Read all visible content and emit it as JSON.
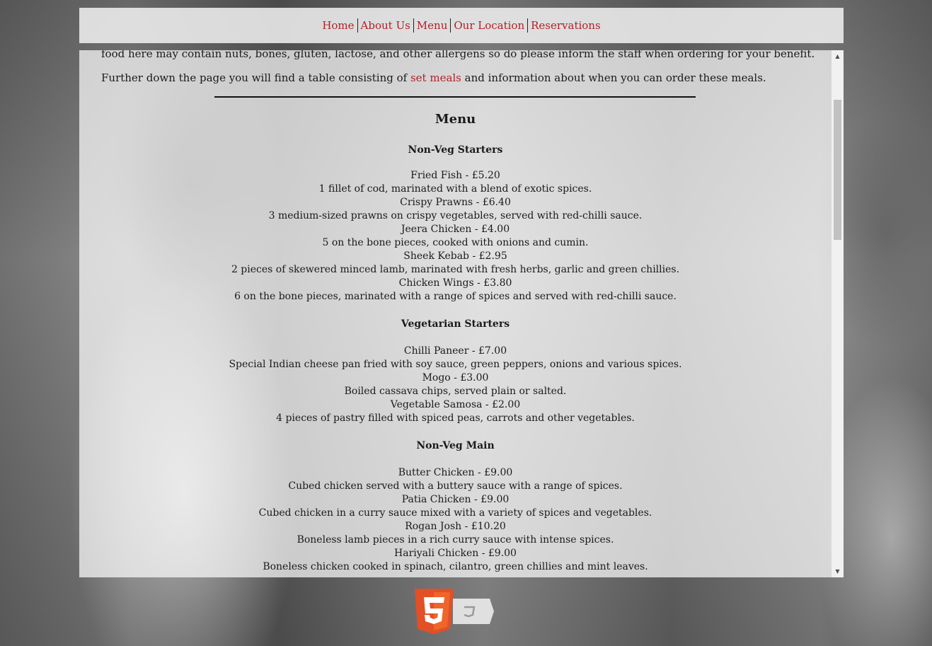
{
  "nav": {
    "items": [
      "Home",
      "About Us",
      "Menu",
      "Our Location",
      "Reservations"
    ]
  },
  "intro": {
    "allergen_line": "food here may contain nuts, bones, gluten, lactose, and other allergens so do please inform the staff when ordering for your benefit.",
    "set_meals_before": "Further down the page you will find a table consisting of ",
    "set_meals_link": "set meals",
    "set_meals_after": " and information about when you can order these meals."
  },
  "menu": {
    "title": "Menu",
    "sections": [
      {
        "title": "Non-Veg Starters",
        "items": [
          {
            "name": "Fried Fish - £5.20",
            "desc": "1 fillet of cod, marinated with a blend of exotic spices."
          },
          {
            "name": "Crispy Prawns - £6.40",
            "desc": "3 medium-sized prawns on crispy vegetables, served with red-chilli sauce."
          },
          {
            "name": "Jeera Chicken - £4.00",
            "desc": "5 on the bone pieces, cooked with onions and cumin."
          },
          {
            "name": "Sheek Kebab - £2.95",
            "desc": "2 pieces of skewered minced lamb, marinated with fresh herbs, garlic and green chillies."
          },
          {
            "name": "Chicken Wings - £3.80",
            "desc": "6 on the bone pieces, marinated with a range of spices and served with red-chilli sauce."
          }
        ]
      },
      {
        "title": "Vegetarian Starters",
        "items": [
          {
            "name": "Chilli Paneer - £7.00",
            "desc": "Special Indian cheese pan fried with soy sauce, green peppers, onions and various spices."
          },
          {
            "name": "Mogo - £3.00",
            "desc": "Boiled cassava chips, served plain or salted."
          },
          {
            "name": "Vegetable Samosa - £2.00",
            "desc": "4 pieces of pastry filled with spiced peas, carrots and other vegetables."
          }
        ]
      },
      {
        "title": "Non-Veg Main",
        "items": [
          {
            "name": "Butter Chicken - £9.00",
            "desc": "Cubed chicken served with a buttery sauce with a range of spices."
          },
          {
            "name": "Patia Chicken - £9.00",
            "desc": "Cubed chicken in a curry sauce mixed with a variety of spices and vegetables."
          },
          {
            "name": "Rogan Josh - £10.20",
            "desc": "Boneless lamb pieces in a rich curry sauce with intense spices."
          },
          {
            "name": "Hariyali Chicken - £9.00",
            "desc": "Boneless chicken cooked in spinach, cilantro, green chillies and mint leaves."
          }
        ]
      }
    ]
  },
  "badge": {
    "icon": "html5-logo-icon",
    "colors": {
      "shield": "#e34f26",
      "shield_light": "#f06529",
      "tab": "#ebebeb"
    }
  },
  "colors": {
    "accent": "#b2202a",
    "nav_bg": "#eeeeee",
    "text": "#1a1a1a"
  }
}
